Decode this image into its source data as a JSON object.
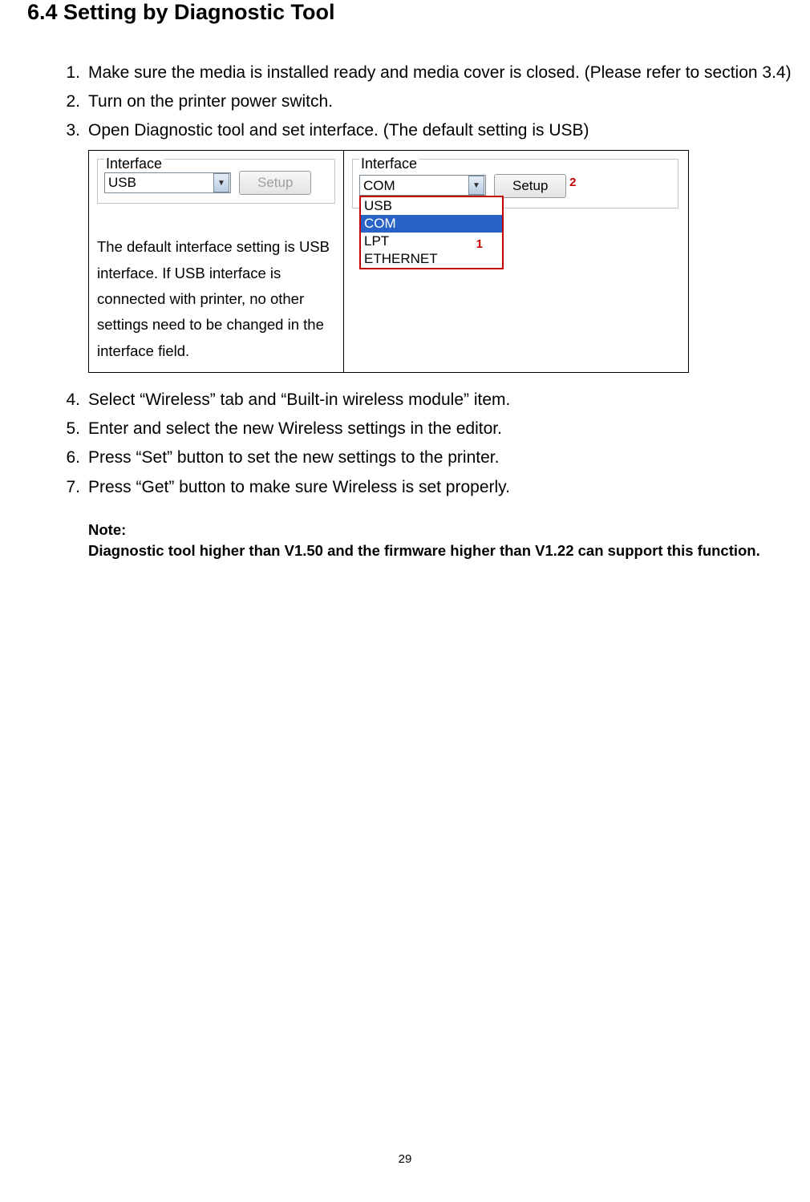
{
  "title": "6.4   Setting by Diagnostic Tool",
  "steps": [
    "Make sure the media is installed ready and media cover is closed. (Please refer to section 3.4)",
    "Turn on the printer power switch.",
    "Open Diagnostic tool and set interface. (The default setting is USB)",
    "Select “Wireless” tab and “Built-in wireless module” item.",
    "Enter and select the new Wireless settings in the editor.",
    "Press “Set” button to set the new settings to the printer.",
    "Press “Get” button to make sure Wireless is set properly."
  ],
  "left_panel": {
    "group_label": "Interface",
    "combo_value": "USB",
    "button_label": "Setup",
    "explanation": "The default interface setting is USB interface. If USB interface is connected with printer, no other settings need to be changed in the interface field."
  },
  "right_panel": {
    "group_label": "Interface",
    "combo_value": "COM",
    "button_label": "Setup",
    "options": [
      "USB",
      "COM",
      "LPT",
      "ETHERNET"
    ],
    "selected_option_index": 1,
    "callout1": "1",
    "callout2": "2"
  },
  "note": {
    "heading": "Note:",
    "body": "Diagnostic tool higher than V1.50 and the firmware higher than V1.22 can support this function."
  },
  "page_number": "29"
}
